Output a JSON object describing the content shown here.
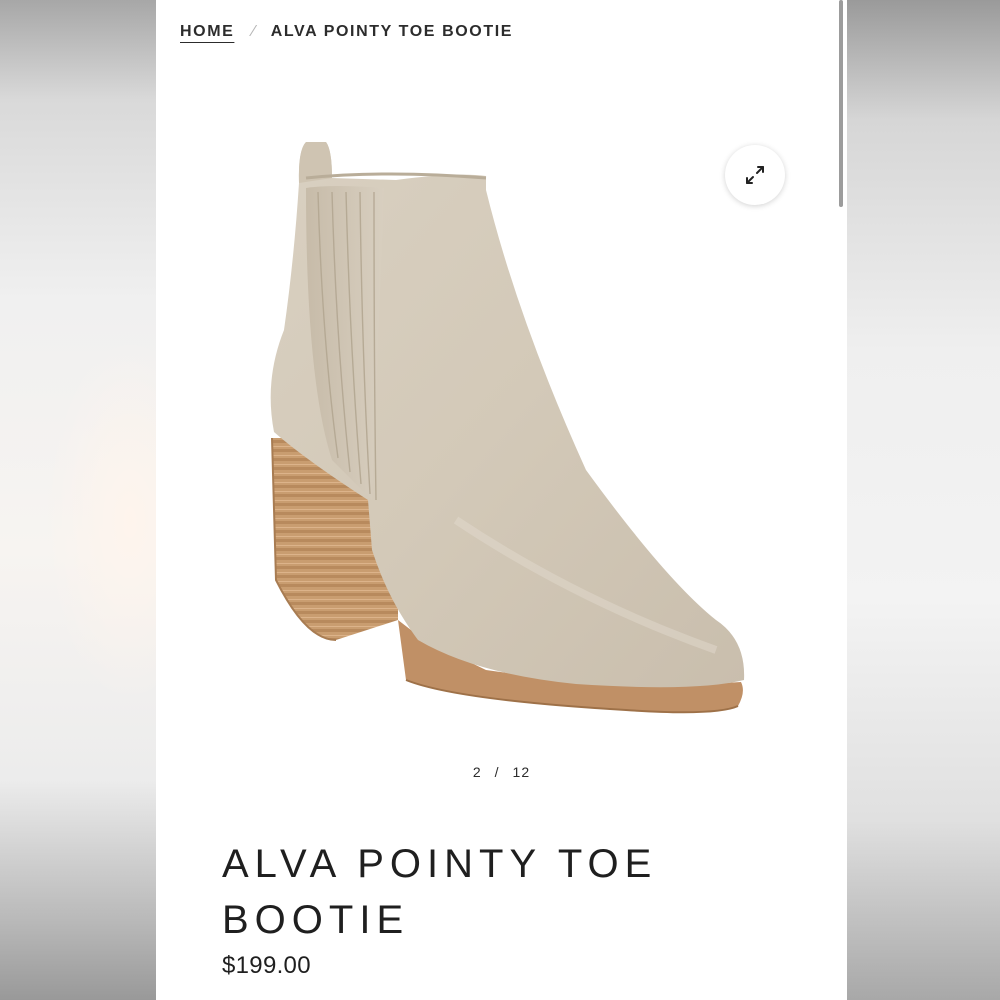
{
  "breadcrumb": {
    "home_label": "HOME",
    "separator": "⁄",
    "current_label": "ALVA POINTY TOE BOOTIE"
  },
  "gallery": {
    "current_index": "2",
    "separator": "/",
    "total": "12",
    "expand_icon": "expand-icon"
  },
  "product": {
    "title": "ALVA POINTY TOE BOOTIE",
    "price": "$199.00"
  },
  "colors": {
    "page_bg": "#ffffff",
    "text": "#1f1f1f",
    "suede": "#d6ccbc",
    "heel_wood": "#c79a6c"
  }
}
